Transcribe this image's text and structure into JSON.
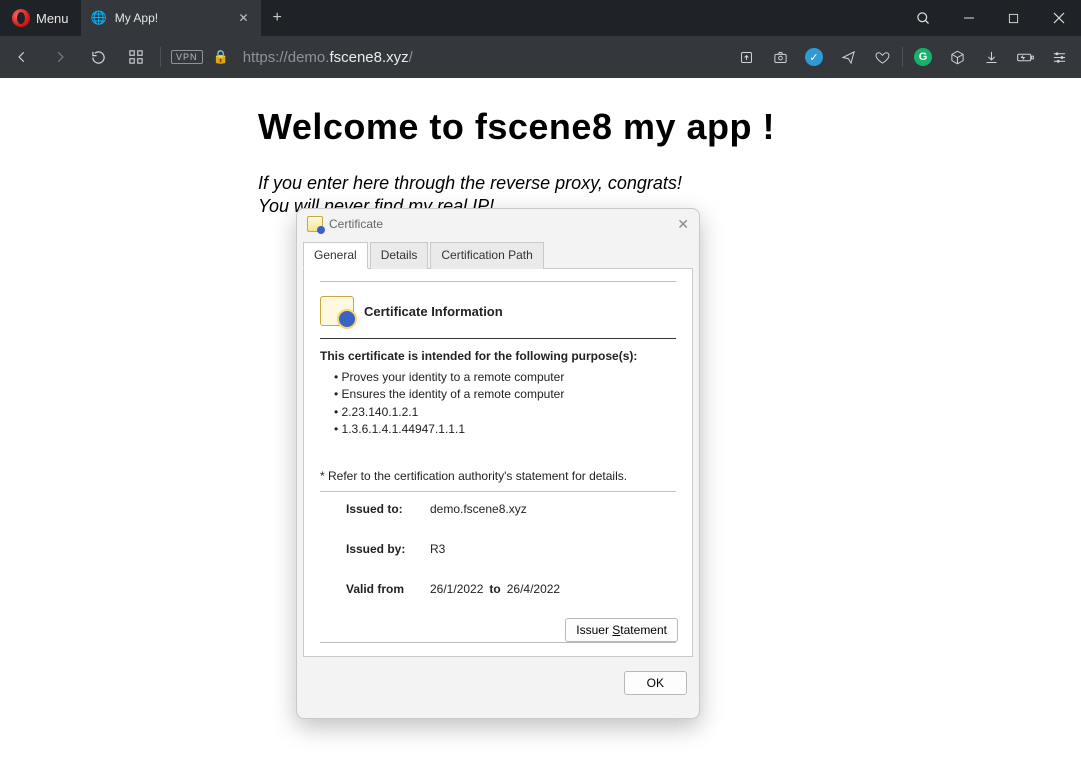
{
  "window": {
    "menu_label": "Menu",
    "tab_title": "My App!"
  },
  "addr": {
    "vpn_label": "VPN",
    "url_scheme": "https://",
    "url_sub": "demo.",
    "url_host": "fscene8.xyz",
    "url_path": "/"
  },
  "page": {
    "heading": "Welcome to fscene8 my app !",
    "line1": "If you enter here through the reverse proxy, congrats!",
    "line2": "You will never find my real IP!"
  },
  "cert": {
    "dialog_title": "Certificate",
    "tabs": {
      "general": "General",
      "details": "Details",
      "certpath": "Certification Path"
    },
    "info_title": "Certificate Information",
    "purpose_head": "This certificate is intended for the following purpose(s):",
    "purposes": [
      "Proves your identity to a remote computer",
      "Ensures the identity of a remote computer",
      "2.23.140.1.2.1",
      "1.3.6.1.4.1.44947.1.1.1"
    ],
    "refer": "* Refer to the certification authority's statement for details.",
    "issued_to_label": "Issued to:",
    "issued_to": "demo.fscene8.xyz",
    "issued_by_label": "Issued by:",
    "issued_by": "R3",
    "valid_from_label": "Valid from",
    "valid_from": "26/1/2022",
    "valid_to_label": "to",
    "valid_to": "26/4/2022",
    "issuer_statement_pre": "Issuer ",
    "issuer_statement_u": "S",
    "issuer_statement_post": "tatement",
    "ok": "OK"
  }
}
